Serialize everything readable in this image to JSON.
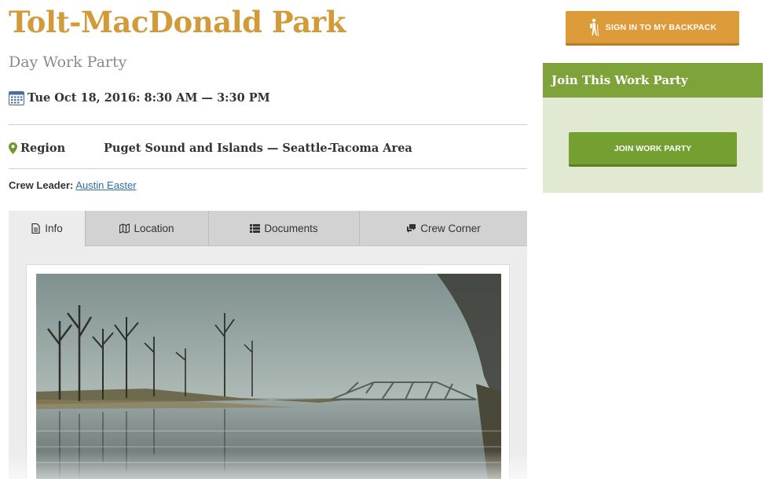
{
  "event": {
    "title": "Tolt-MacDonald Park",
    "subtitle": "Day Work Party",
    "datetime": "Tue Oct 18, 2016: 8:30 AM — 3:30 PM",
    "region_label": "Region",
    "region_value": "Puget Sound and Islands — Seattle-Tacoma Area",
    "crew_leader_label": "Crew Leader:",
    "crew_leader_name": "Austin Easter"
  },
  "tabs": [
    {
      "label": "Info",
      "icon": "document-icon",
      "active": true
    },
    {
      "label": "Location",
      "icon": "map-icon",
      "active": false
    },
    {
      "label": "Documents",
      "icon": "list-icon",
      "active": false
    },
    {
      "label": "Crew Corner",
      "icon": "comments-icon",
      "active": false
    }
  ],
  "photo": {
    "alt": "River with bare trees and a steel truss bridge"
  },
  "sidebar": {
    "signin_label": "SIGN IN TO MY BACKPACK",
    "join_heading": "Join This Work Party",
    "join_button_label": "JOIN WORK PARTY"
  },
  "colors": {
    "title": "#d39a3a",
    "signin_button": "#de9b3a",
    "join_header": "#7ea33a",
    "join_panel": "#e1e9d2",
    "join_button": "#74a032",
    "link": "#2a6fa8",
    "pin": "#6a9a2f"
  }
}
